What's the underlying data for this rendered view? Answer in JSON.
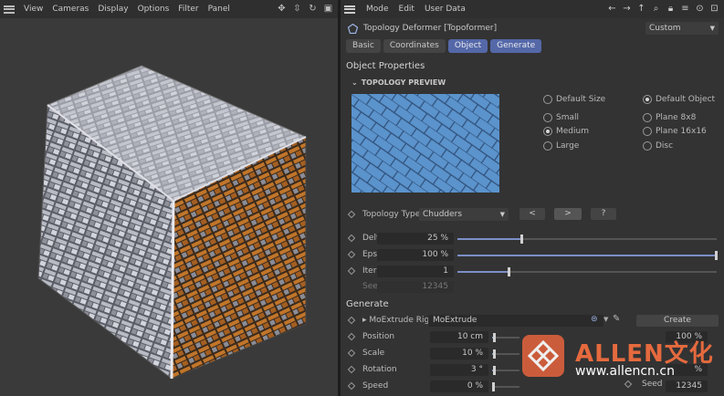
{
  "viewport": {
    "menu": [
      "View",
      "Cameras",
      "Display",
      "Options",
      "Filter",
      "Panel"
    ]
  },
  "attributes": {
    "menu": [
      "Mode",
      "Edit",
      "User Data"
    ],
    "object_title": "Topology Deformer [Topoformer]",
    "preset_dropdown": "Custom",
    "tabs": [
      {
        "label": "Basic",
        "active": false
      },
      {
        "label": "Coordinates",
        "active": false
      },
      {
        "label": "Object",
        "active": true
      },
      {
        "label": "Generate",
        "active": true
      }
    ],
    "object_properties_heading": "Object Properties",
    "topology_preview_heading": "TOPOLOGY PREVIEW",
    "size_options": [
      {
        "label": "Default Size",
        "selected": false
      },
      {
        "label": "Small",
        "selected": false
      },
      {
        "label": "Medium",
        "selected": true
      },
      {
        "label": "Large",
        "selected": false
      }
    ],
    "object_options": [
      {
        "label": "Default Object",
        "selected": true
      },
      {
        "label": "Plane 8x8",
        "selected": false
      },
      {
        "label": "Plane 16x16",
        "selected": false
      },
      {
        "label": "Disc",
        "selected": false
      }
    ],
    "topology_type": {
      "label": "Topology Type",
      "value": "Chudders",
      "prev_button": "<",
      "next_button": ">",
      "help_button": "?"
    },
    "delta": {
      "label": "Delta",
      "value": "25 %",
      "fraction": 0.25
    },
    "epsilon": {
      "label": "Epsilon",
      "value": "100 %",
      "fraction": 1.0
    },
    "iterations": {
      "label": "Iterations",
      "value": "1",
      "fraction": 0.2
    },
    "seed": {
      "label": "Seed",
      "value": "12345"
    },
    "generate_heading": "Generate",
    "moextrude_rig": {
      "label": "MoExtrude Rig",
      "value": "MoExtrude",
      "create_button": "Create"
    },
    "position": {
      "label": "Position",
      "value": "10 cm",
      "fraction": 0.1
    },
    "scale": {
      "label": "Scale",
      "value": "10 %",
      "fraction": 0.1
    },
    "rotation": {
      "label": "Rotation",
      "value": "3 °",
      "fraction": 0.1
    },
    "speed": {
      "label": "Speed",
      "value": "0 %",
      "fraction": 0.0
    },
    "right_col": {
      "row1_value": "100 %",
      "row4_value": "%",
      "seed_label": "Seed",
      "seed_value": "12345"
    }
  },
  "watermark": {
    "brand": "ALLEN文化",
    "url": "www.allencn.cn"
  },
  "colors": {
    "accent_tab": "#5468a8",
    "preview_blue": "#5b93cc",
    "watermark_orange": "#e56a3e"
  }
}
